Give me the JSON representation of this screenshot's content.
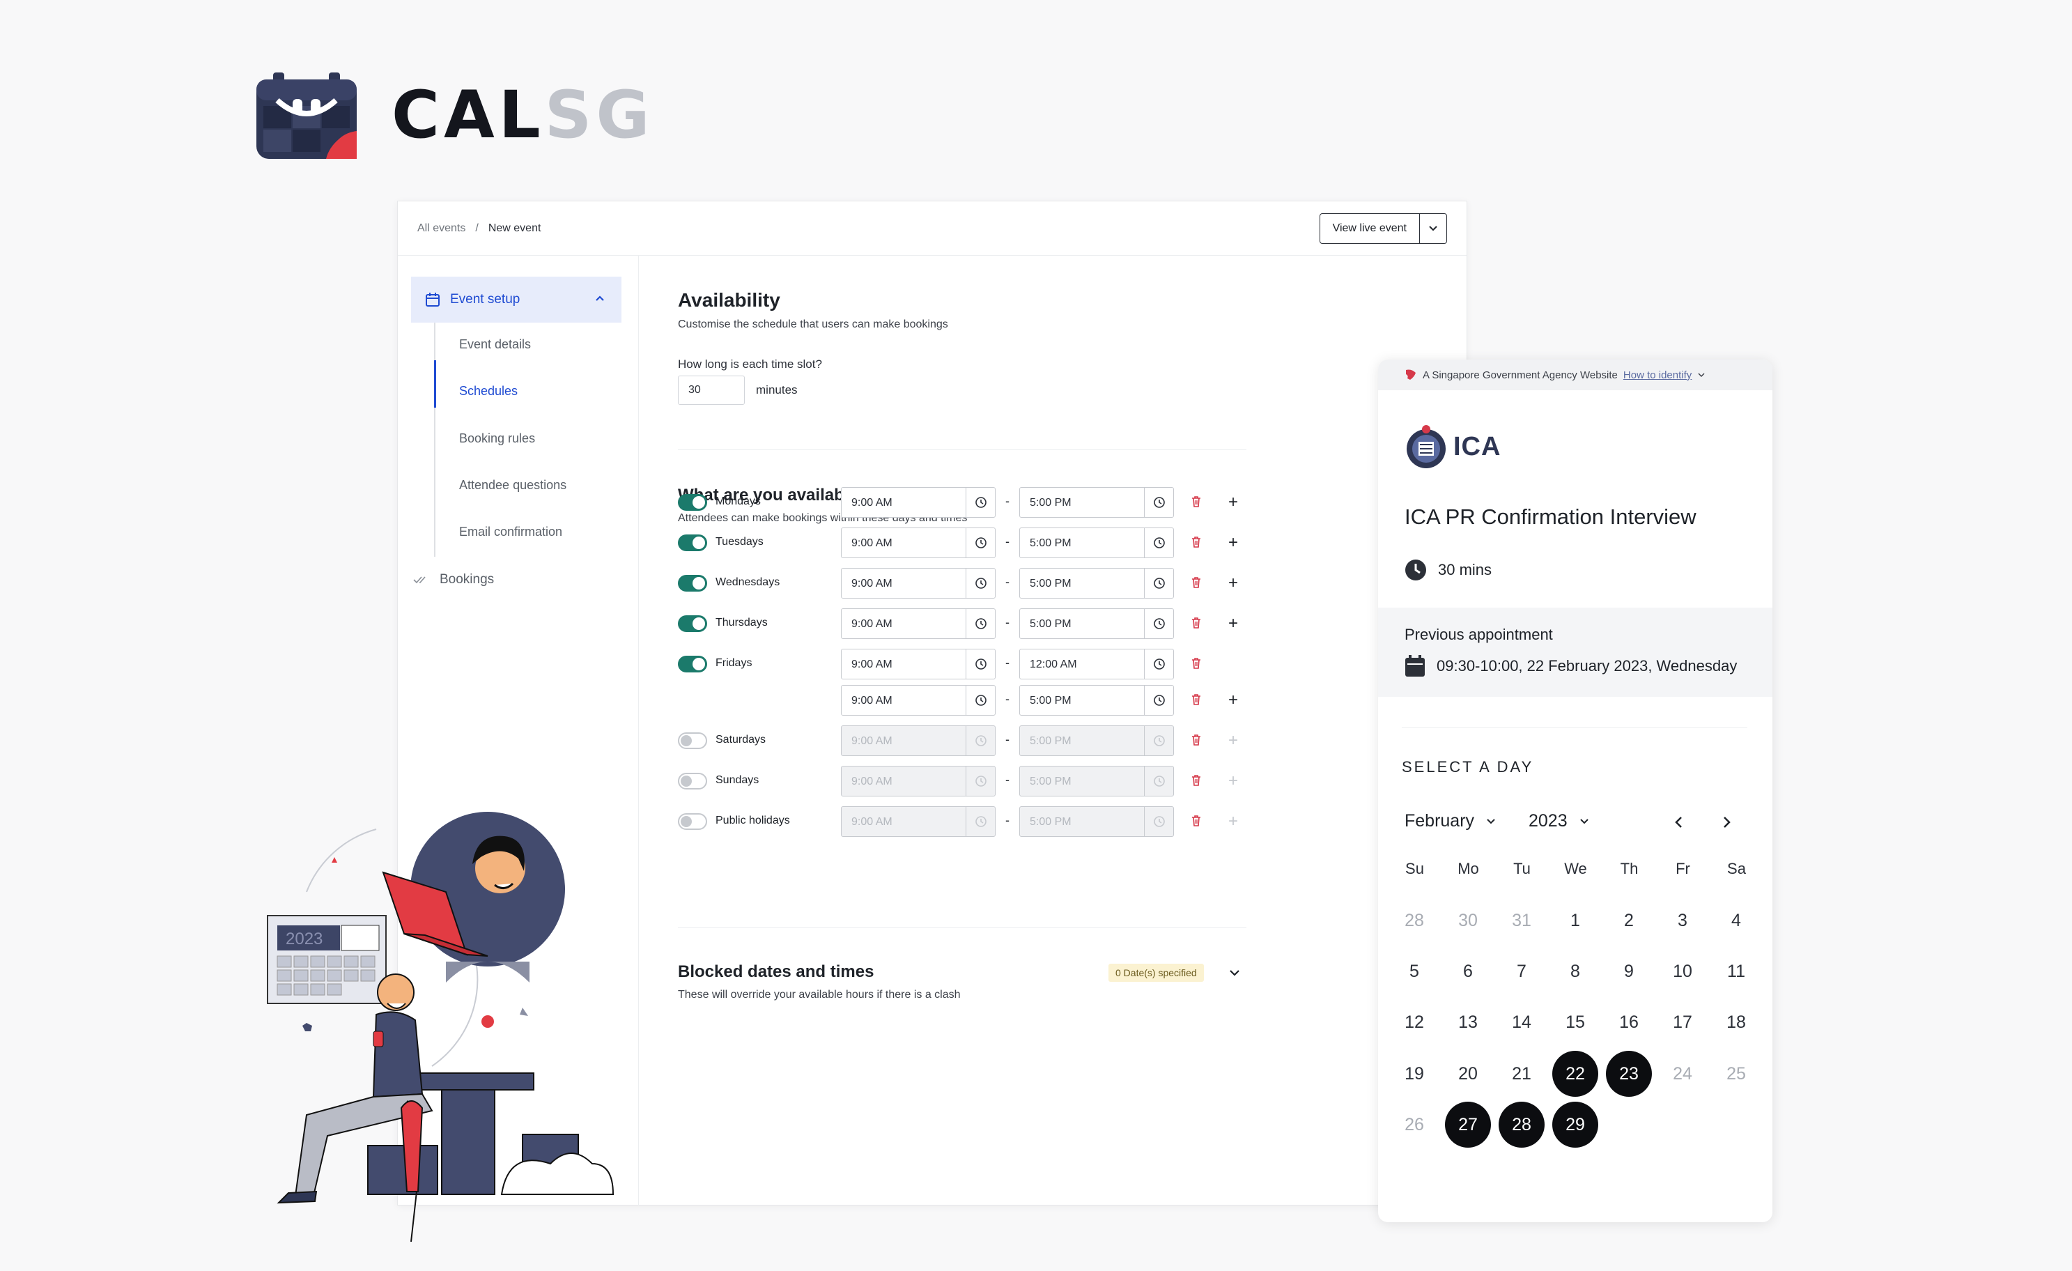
{
  "brand": {
    "word1": "CAL",
    "word2": "SG"
  },
  "admin": {
    "breadcrumb": {
      "all": "All events",
      "sep": "/",
      "current": "New event"
    },
    "view_live": "View live event",
    "sidebar": {
      "setup_label": "Event setup",
      "items": [
        {
          "label": "Event details",
          "active": false
        },
        {
          "label": "Schedules",
          "active": true
        },
        {
          "label": "Booking rules",
          "active": false
        },
        {
          "label": "Attendee questions",
          "active": false
        },
        {
          "label": "Email confirmation",
          "active": false
        }
      ],
      "bookings_label": "Bookings"
    },
    "availability": {
      "title": "Availability",
      "subtitle": "Customise the schedule that users can make bookings",
      "slot_question": "How long is each time slot?",
      "slot_value": "30",
      "slot_unit": "minutes"
    },
    "hours": {
      "title": "What are you available hours?",
      "subtitle": "Attendees can make bookings within these days and times",
      "rows": [
        {
          "day": "Mondays",
          "on": true,
          "start": "9:00 AM",
          "end": "5:00 PM",
          "plus": true
        },
        {
          "day": "Tuesdays",
          "on": true,
          "start": "9:00 AM",
          "end": "5:00 PM",
          "plus": true
        },
        {
          "day": "Wednesdays",
          "on": true,
          "start": "9:00 AM",
          "end": "5:00 PM",
          "plus": true
        },
        {
          "day": "Thursdays",
          "on": true,
          "start": "9:00 AM",
          "end": "5:00 PM",
          "plus": true
        },
        {
          "day": "Fridays",
          "on": true,
          "start": "9:00 AM",
          "end": "12:00 AM",
          "plus": false
        },
        {
          "day": "",
          "on": true,
          "start": "9:00 AM",
          "end": "5:00 PM",
          "plus": true
        },
        {
          "day": "Saturdays",
          "on": false,
          "start": "9:00 AM",
          "end": "5:00 PM",
          "plus": true
        },
        {
          "day": "Sundays",
          "on": false,
          "start": "9:00 AM",
          "end": "5:00 PM",
          "plus": true
        },
        {
          "day": "Public holidays",
          "on": false,
          "start": "9:00 AM",
          "end": "5:00 PM",
          "plus": true
        }
      ],
      "separator": "-"
    },
    "blocked": {
      "title": "Blocked dates and times",
      "subtitle": "These will override your available hours if there is a clash",
      "badge": "0 Date(s) specified"
    }
  },
  "booking": {
    "gov_banner": "A Singapore Government Agency Website",
    "gov_link": "How to identify",
    "agency": "ICA",
    "title": "ICA PR Confirmation Interview",
    "duration": "30 mins",
    "prev_label": "Previous appointment",
    "prev_value": "09:30-10:00, 22 February 2023, Wednesday",
    "select_label": "SELECT A DAY",
    "month": "February",
    "year": "2023",
    "weekdays": [
      "Su",
      "Mo",
      "Tu",
      "We",
      "Th",
      "Fr",
      "Sa"
    ],
    "days": [
      {
        "d": "28",
        "s": "muted"
      },
      {
        "d": "30",
        "s": "muted"
      },
      {
        "d": "31",
        "s": "muted"
      },
      {
        "d": "1",
        "s": ""
      },
      {
        "d": "2",
        "s": ""
      },
      {
        "d": "3",
        "s": ""
      },
      {
        "d": "4",
        "s": ""
      },
      {
        "d": "5",
        "s": ""
      },
      {
        "d": "6",
        "s": ""
      },
      {
        "d": "7",
        "s": ""
      },
      {
        "d": "8",
        "s": ""
      },
      {
        "d": "9",
        "s": ""
      },
      {
        "d": "10",
        "s": ""
      },
      {
        "d": "11",
        "s": ""
      },
      {
        "d": "12",
        "s": ""
      },
      {
        "d": "13",
        "s": ""
      },
      {
        "d": "14",
        "s": ""
      },
      {
        "d": "15",
        "s": ""
      },
      {
        "d": "16",
        "s": ""
      },
      {
        "d": "17",
        "s": ""
      },
      {
        "d": "18",
        "s": ""
      },
      {
        "d": "19",
        "s": ""
      },
      {
        "d": "20",
        "s": ""
      },
      {
        "d": "21",
        "s": ""
      },
      {
        "d": "22",
        "s": "sel"
      },
      {
        "d": "23",
        "s": "sel"
      },
      {
        "d": "24",
        "s": "muted"
      },
      {
        "d": "25",
        "s": "muted"
      },
      {
        "d": "26",
        "s": "muted"
      },
      {
        "d": "27",
        "s": "sel"
      },
      {
        "d": "28",
        "s": "sel"
      },
      {
        "d": "29",
        "s": "sel"
      }
    ]
  },
  "illustration": {
    "calendar_year": "2023"
  },
  "colors": {
    "accent_blue": "#1f4bd2",
    "toggle_green": "#1b7a6b",
    "danger": "#d6394a",
    "brand_red": "#e23b43",
    "navy": "#2e3654"
  }
}
